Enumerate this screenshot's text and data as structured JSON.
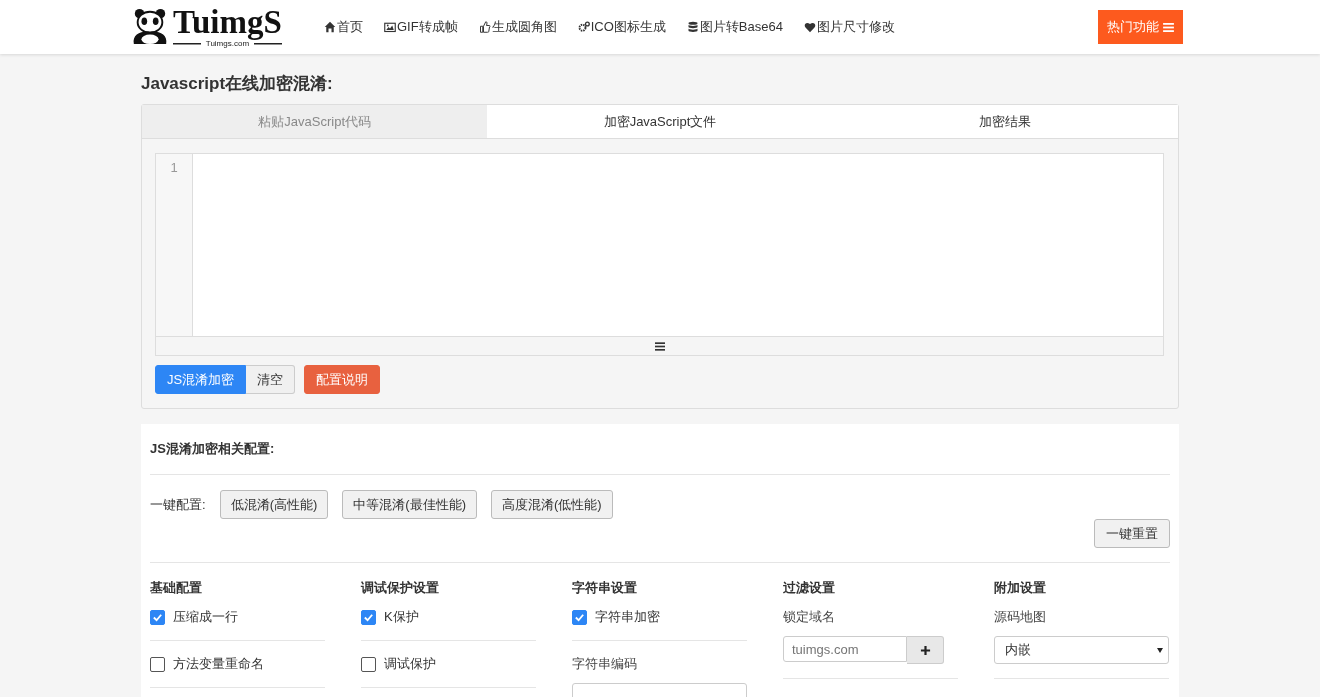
{
  "header": {
    "logo": {
      "title": "TuimgS",
      "subtitle": "Tuimgs.com"
    },
    "nav": [
      {
        "label": "首页"
      },
      {
        "label": "GIF转成帧"
      },
      {
        "label": "生成圆角图"
      },
      {
        "label": "ICO图标生成"
      },
      {
        "label": "图片转Base64"
      },
      {
        "label": "图片尺寸修改"
      }
    ],
    "hot_button": "热门功能"
  },
  "page_title": "Javascript在线加密混淆:",
  "tabs": [
    {
      "label": "粘贴JavaScript代码",
      "selected": true
    },
    {
      "label": "加密JavaScript文件",
      "selected": false
    },
    {
      "label": "加密结果",
      "selected": false
    }
  ],
  "editor": {
    "line_numbers": [
      "1"
    ]
  },
  "actions": [
    {
      "label": "JS混淆加密",
      "kind": "primary"
    },
    {
      "label": "清空",
      "kind": "default"
    },
    {
      "label": "配置说明",
      "kind": "danger"
    }
  ],
  "config": {
    "title": "JS混淆加密相关配置:",
    "preset_label": "一键配置:",
    "presets": [
      "低混淆(高性能)",
      "中等混淆(最佳性能)",
      "高度混淆(低性能)"
    ],
    "reset": "一键重置",
    "columns": [
      {
        "heading": "基础配置",
        "items": [
          {
            "kind": "checkbox",
            "label": "压缩成一行",
            "checked": true
          },
          {
            "kind": "checkbox",
            "label": "方法变量重命名",
            "checked": false
          }
        ]
      },
      {
        "heading": "调试保护设置",
        "items": [
          {
            "kind": "checkbox",
            "label": "K保护",
            "checked": true
          },
          {
            "kind": "checkbox",
            "label": "调试保护",
            "checked": false
          }
        ]
      },
      {
        "heading": "字符串设置",
        "items": [
          {
            "kind": "checkbox",
            "label": "字符串加密",
            "checked": true
          },
          {
            "kind": "select",
            "label": "字符串编码"
          }
        ]
      },
      {
        "heading": "过滤设置",
        "items": [
          {
            "kind": "addfield",
            "label": "锁定域名",
            "placeholder": "tuimgs.com"
          }
        ]
      },
      {
        "heading": "附加设置",
        "items": [
          {
            "kind": "select",
            "label": "源码地图",
            "value": "内嵌"
          }
        ]
      }
    ]
  }
}
